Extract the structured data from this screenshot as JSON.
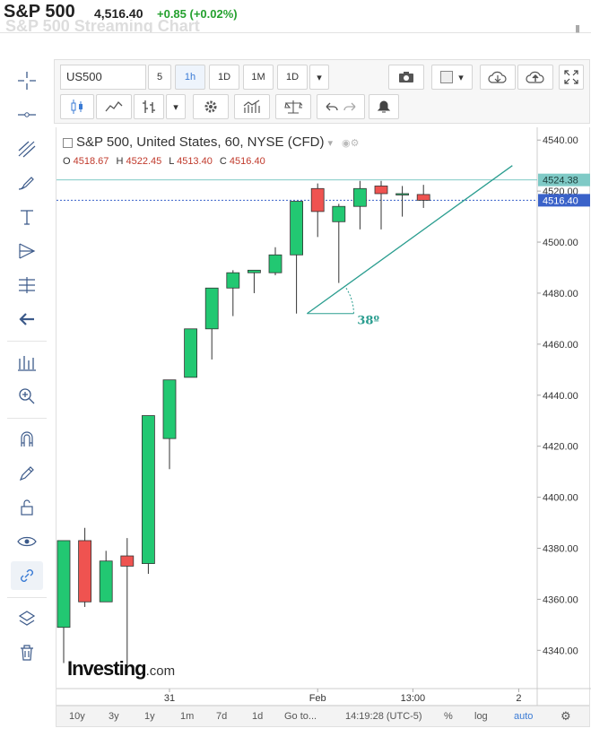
{
  "header": {
    "name": "S&P 500",
    "price": "4,516.40",
    "change": "+0.85 (+0.02%)",
    "ghost_title": "S&P 500 Streaming Chart",
    "colors": {
      "change": "#25a12f"
    }
  },
  "left_toolbar": {
    "icons": [
      "crosshair-icon",
      "horizontal-line-icon",
      "trend-lines-icon",
      "brush-icon",
      "text-icon",
      "pattern-icon",
      "measure-icon",
      "back-arrow-icon",
      "indicators-icon",
      "zoom-in-icon",
      "magnet-icon",
      "lock-drawing-icon",
      "unlock-icon",
      "eye-icon",
      "link-icon",
      "layers-icon",
      "trash-icon"
    ]
  },
  "top_toolbar": {
    "symbol": "US500",
    "intervals": [
      "5",
      "1h",
      "1D",
      "1M",
      "1D"
    ],
    "selected_interval": "1h"
  },
  "legend": {
    "title": "S&P 500, United States, 60, NYSE (CFD)",
    "open_label": "O",
    "open": "4518.67",
    "high_label": "H",
    "high": "4522.45",
    "low_label": "L",
    "low": "4513.40",
    "close_label": "C",
    "close": "4516.40"
  },
  "logo": {
    "brand": "Investing",
    "suffix": ".com"
  },
  "bottom_bar": {
    "ranges": [
      "10y",
      "3y",
      "1y",
      "1m",
      "7d",
      "1d"
    ],
    "goto": "Go to...",
    "time": "14:19:28 (UTC-5)",
    "percent": "%",
    "log": "log",
    "auto": "auto"
  },
  "chart_data": {
    "type": "candlestick",
    "ylim": [
      4325,
      4545
    ],
    "y_ticks": [
      4340,
      4360,
      4380,
      4400,
      4420,
      4440,
      4460,
      4480,
      4500,
      4520,
      4540
    ],
    "x_tick_labels": [
      {
        "label": "31",
        "index": 5
      },
      {
        "label": "Feb",
        "index": 12
      },
      {
        "label": "13:00",
        "index": 16.5
      },
      {
        "label": "2",
        "index": 21.5
      }
    ],
    "candles": [
      {
        "o": 4349,
        "h": 4383,
        "l": 4335,
        "c": 4383
      },
      {
        "o": 4383,
        "h": 4388,
        "l": 4357,
        "c": 4359
      },
      {
        "o": 4359,
        "h": 4379,
        "l": 4359,
        "c": 4375
      },
      {
        "o": 4377,
        "h": 4384,
        "l": 4331,
        "c": 4373
      },
      {
        "o": 4374,
        "h": 4432,
        "l": 4370,
        "c": 4432
      },
      {
        "o": 4423,
        "h": 4446,
        "l": 4411,
        "c": 4446
      },
      {
        "o": 4447,
        "h": 4466,
        "l": 4447,
        "c": 4466
      },
      {
        "o": 4466,
        "h": 4482,
        "l": 4454,
        "c": 4482
      },
      {
        "o": 4482,
        "h": 4489,
        "l": 4471,
        "c": 4488
      },
      {
        "o": 4488,
        "h": 4489,
        "l": 4480,
        "c": 4489
      },
      {
        "o": 4488,
        "h": 4498,
        "l": 4487,
        "c": 4495
      },
      {
        "o": 4495,
        "h": 4516,
        "l": 4472,
        "c": 4516
      },
      {
        "o": 4521,
        "h": 4523,
        "l": 4502,
        "c": 4512
      },
      {
        "o": 4508,
        "h": 4515,
        "l": 4484,
        "c": 4514
      },
      {
        "o": 4514,
        "h": 4524,
        "l": 4505,
        "c": 4521
      },
      {
        "o": 4522,
        "h": 4524,
        "l": 4505,
        "c": 4519
      },
      {
        "o": 4519,
        "h": 4522,
        "l": 4510,
        "c": 4519
      },
      {
        "o": 4518.67,
        "h": 4522.45,
        "l": 4513.4,
        "c": 4516.4
      }
    ],
    "price_labels": [
      {
        "value": 4524.38,
        "label": "4524.38",
        "color": "#7fcac6"
      },
      {
        "value": 4516.4,
        "label": "4516.40",
        "color": "#3a62c9"
      }
    ],
    "trendline": {
      "from": [
        11.5,
        4472
      ],
      "to": [
        21.2,
        4530
      ]
    },
    "angle_label": "38º",
    "colors": {
      "up": "#22c872",
      "down": "#ef5350",
      "trend": "#2a9d8f"
    }
  }
}
